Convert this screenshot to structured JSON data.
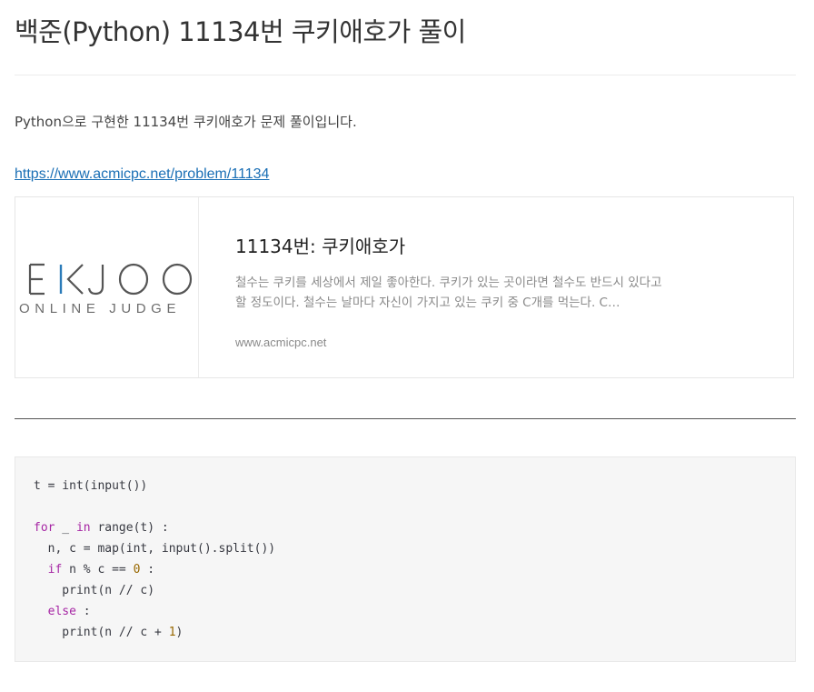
{
  "page": {
    "title": "백준(Python) 11134번 쿠키애호가 풀이",
    "intro": "Python으로 구현한 11134번 쿠키애호가 문제 풀이입니다.",
    "link": "https://www.acmicpc.net/problem/11134"
  },
  "card": {
    "logo_main": "EKJOO",
    "logo_sub": "ONLINE JUDGE",
    "title": "11134번: 쿠키애호가",
    "description": "철수는 쿠키를 세상에서 제일 좋아한다. 쿠키가 있는 곳이라면 철수도 반드시 있다고 할 정도이다. 철수는 날마다 자신이 가지고 있는 쿠키 중 C개를 먹는다. C…",
    "url": "www.acmicpc.net"
  },
  "code": {
    "lines": [
      [
        {
          "t": "t = int(input())"
        }
      ],
      [
        {
          "t": ""
        }
      ],
      [
        {
          "t": "for",
          "c": "kw"
        },
        {
          "t": " _ "
        },
        {
          "t": "in",
          "c": "kw"
        },
        {
          "t": " range(t) :"
        }
      ],
      [
        {
          "t": "  n, c = map(int, input().split())"
        }
      ],
      [
        {
          "t": "  "
        },
        {
          "t": "if",
          "c": "kw"
        },
        {
          "t": " n % c == "
        },
        {
          "t": "0",
          "c": "num"
        },
        {
          "t": " :"
        }
      ],
      [
        {
          "t": "    print(n // c)"
        }
      ],
      [
        {
          "t": "  "
        },
        {
          "t": "else",
          "c": "kw"
        },
        {
          "t": " :"
        }
      ],
      [
        {
          "t": "    print(n // c + "
        },
        {
          "t": "1",
          "c": "num"
        },
        {
          "t": ")"
        }
      ]
    ]
  },
  "colors": {
    "link": "#1a6fb5",
    "keyword": "#a626a4",
    "number": "#986801",
    "logo_accent": "#2b7bb9"
  }
}
